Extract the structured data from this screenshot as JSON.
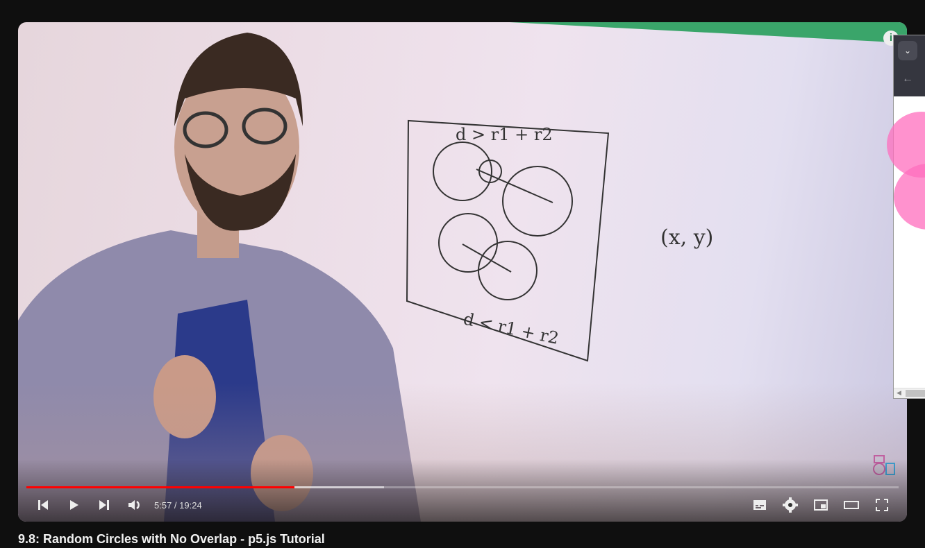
{
  "video": {
    "title": "9.8: Random Circles with No Overlap - p5.js Tutorial",
    "current_time": "5:57",
    "duration": "19:24",
    "time_display": "5:57 / 19:24",
    "progress_percent": 30.7,
    "buffered_percent": 41,
    "whiteboard_text": [
      "d > r1 + r2",
      "d < r1 + r2",
      "(x, y)"
    ],
    "info_icon": "i"
  },
  "controls": {
    "left": [
      "previous-icon",
      "play-icon",
      "next-icon",
      "volume-icon"
    ],
    "right": [
      "subtitles-icon",
      "settings-icon",
      "miniplayer-icon",
      "theater-icon",
      "fullscreen-icon"
    ]
  },
  "colors": {
    "progress": "#ff0000",
    "background": "#0f0f0f"
  }
}
